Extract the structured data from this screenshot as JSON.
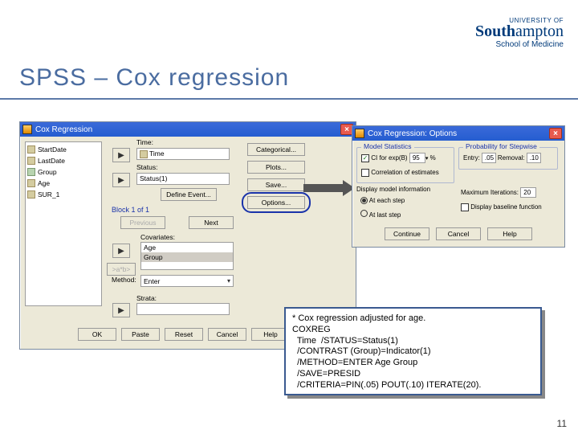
{
  "logo": {
    "top": "UNIVERSITY OF",
    "main_left": "South",
    "main_right": "ampton",
    "sub": "School of Medicine"
  },
  "title": "SPSS – Cox regression",
  "page_num": "11",
  "main_dialog": {
    "title": "Cox Regression",
    "vars": [
      "StartDate",
      "LastDate",
      "Group",
      "Age",
      "SUR_1"
    ],
    "time_label": "Time:",
    "time_value": "Time",
    "status_label": "Status:",
    "status_value": "Status(1)",
    "define_event": "Define Event...",
    "block_title": "Block 1 of 1",
    "prev": "Previous",
    "next": "Next",
    "cov_label": "Covariates:",
    "cov_items": [
      "Age",
      "Group"
    ],
    "axb": ">a*b>",
    "method_label": "Method:",
    "method_value": "Enter",
    "strata_label": "Strata:",
    "buttons": [
      "OK",
      "Paste",
      "Reset",
      "Cancel",
      "Help"
    ],
    "side_buttons": [
      "Categorical...",
      "Plots...",
      "Save...",
      "Options..."
    ]
  },
  "options_dialog": {
    "title": "Cox Regression: Options",
    "model_stats": "Model Statistics",
    "ci_label": "CI for exp(B)",
    "ci_value": "95",
    "ci_percent": "%",
    "corr": "Correlation of estimates",
    "prob_step": "Probability for Stepwise",
    "entry_label": "Entry:",
    "entry_value": ".05",
    "removal_label": "Removal:",
    "removal_value": ".10",
    "display": "Display model information",
    "each_step": "At each step",
    "last_step": "At last step",
    "max_iter_label": "Maximum Iterations:",
    "max_iter_value": "20",
    "baseline": "Display baseline function",
    "buttons": [
      "Continue",
      "Cancel",
      "Help"
    ]
  },
  "syntax": "* Cox regression adjusted for age.\nCOXREG\n  Time  /STATUS=Status(1)\n  /CONTRAST (Group)=Indicator(1)\n  /METHOD=ENTER Age Group\n  /SAVE=PRESID\n  /CRITERIA=PIN(.05) POUT(.10) ITERATE(20)."
}
